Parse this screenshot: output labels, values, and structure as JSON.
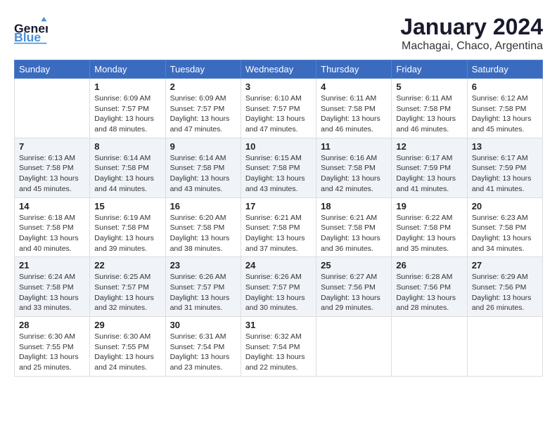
{
  "header": {
    "logo_general": "General",
    "logo_blue": "Blue",
    "month": "January 2024",
    "location": "Machagai, Chaco, Argentina"
  },
  "weekdays": [
    "Sunday",
    "Monday",
    "Tuesday",
    "Wednesday",
    "Thursday",
    "Friday",
    "Saturday"
  ],
  "weeks": [
    [
      {
        "day": "",
        "sunrise": "",
        "sunset": "",
        "daylight": ""
      },
      {
        "day": "1",
        "sunrise": "Sunrise: 6:09 AM",
        "sunset": "Sunset: 7:57 PM",
        "daylight": "Daylight: 13 hours and 48 minutes."
      },
      {
        "day": "2",
        "sunrise": "Sunrise: 6:09 AM",
        "sunset": "Sunset: 7:57 PM",
        "daylight": "Daylight: 13 hours and 47 minutes."
      },
      {
        "day": "3",
        "sunrise": "Sunrise: 6:10 AM",
        "sunset": "Sunset: 7:57 PM",
        "daylight": "Daylight: 13 hours and 47 minutes."
      },
      {
        "day": "4",
        "sunrise": "Sunrise: 6:11 AM",
        "sunset": "Sunset: 7:58 PM",
        "daylight": "Daylight: 13 hours and 46 minutes."
      },
      {
        "day": "5",
        "sunrise": "Sunrise: 6:11 AM",
        "sunset": "Sunset: 7:58 PM",
        "daylight": "Daylight: 13 hours and 46 minutes."
      },
      {
        "day": "6",
        "sunrise": "Sunrise: 6:12 AM",
        "sunset": "Sunset: 7:58 PM",
        "daylight": "Daylight: 13 hours and 45 minutes."
      }
    ],
    [
      {
        "day": "7",
        "sunrise": "Sunrise: 6:13 AM",
        "sunset": "Sunset: 7:58 PM",
        "daylight": "Daylight: 13 hours and 45 minutes."
      },
      {
        "day": "8",
        "sunrise": "Sunrise: 6:14 AM",
        "sunset": "Sunset: 7:58 PM",
        "daylight": "Daylight: 13 hours and 44 minutes."
      },
      {
        "day": "9",
        "sunrise": "Sunrise: 6:14 AM",
        "sunset": "Sunset: 7:58 PM",
        "daylight": "Daylight: 13 hours and 43 minutes."
      },
      {
        "day": "10",
        "sunrise": "Sunrise: 6:15 AM",
        "sunset": "Sunset: 7:58 PM",
        "daylight": "Daylight: 13 hours and 43 minutes."
      },
      {
        "day": "11",
        "sunrise": "Sunrise: 6:16 AM",
        "sunset": "Sunset: 7:58 PM",
        "daylight": "Daylight: 13 hours and 42 minutes."
      },
      {
        "day": "12",
        "sunrise": "Sunrise: 6:17 AM",
        "sunset": "Sunset: 7:59 PM",
        "daylight": "Daylight: 13 hours and 41 minutes."
      },
      {
        "day": "13",
        "sunrise": "Sunrise: 6:17 AM",
        "sunset": "Sunset: 7:59 PM",
        "daylight": "Daylight: 13 hours and 41 minutes."
      }
    ],
    [
      {
        "day": "14",
        "sunrise": "Sunrise: 6:18 AM",
        "sunset": "Sunset: 7:58 PM",
        "daylight": "Daylight: 13 hours and 40 minutes."
      },
      {
        "day": "15",
        "sunrise": "Sunrise: 6:19 AM",
        "sunset": "Sunset: 7:58 PM",
        "daylight": "Daylight: 13 hours and 39 minutes."
      },
      {
        "day": "16",
        "sunrise": "Sunrise: 6:20 AM",
        "sunset": "Sunset: 7:58 PM",
        "daylight": "Daylight: 13 hours and 38 minutes."
      },
      {
        "day": "17",
        "sunrise": "Sunrise: 6:21 AM",
        "sunset": "Sunset: 7:58 PM",
        "daylight": "Daylight: 13 hours and 37 minutes."
      },
      {
        "day": "18",
        "sunrise": "Sunrise: 6:21 AM",
        "sunset": "Sunset: 7:58 PM",
        "daylight": "Daylight: 13 hours and 36 minutes."
      },
      {
        "day": "19",
        "sunrise": "Sunrise: 6:22 AM",
        "sunset": "Sunset: 7:58 PM",
        "daylight": "Daylight: 13 hours and 35 minutes."
      },
      {
        "day": "20",
        "sunrise": "Sunrise: 6:23 AM",
        "sunset": "Sunset: 7:58 PM",
        "daylight": "Daylight: 13 hours and 34 minutes."
      }
    ],
    [
      {
        "day": "21",
        "sunrise": "Sunrise: 6:24 AM",
        "sunset": "Sunset: 7:58 PM",
        "daylight": "Daylight: 13 hours and 33 minutes."
      },
      {
        "day": "22",
        "sunrise": "Sunrise: 6:25 AM",
        "sunset": "Sunset: 7:57 PM",
        "daylight": "Daylight: 13 hours and 32 minutes."
      },
      {
        "day": "23",
        "sunrise": "Sunrise: 6:26 AM",
        "sunset": "Sunset: 7:57 PM",
        "daylight": "Daylight: 13 hours and 31 minutes."
      },
      {
        "day": "24",
        "sunrise": "Sunrise: 6:26 AM",
        "sunset": "Sunset: 7:57 PM",
        "daylight": "Daylight: 13 hours and 30 minutes."
      },
      {
        "day": "25",
        "sunrise": "Sunrise: 6:27 AM",
        "sunset": "Sunset: 7:56 PM",
        "daylight": "Daylight: 13 hours and 29 minutes."
      },
      {
        "day": "26",
        "sunrise": "Sunrise: 6:28 AM",
        "sunset": "Sunset: 7:56 PM",
        "daylight": "Daylight: 13 hours and 28 minutes."
      },
      {
        "day": "27",
        "sunrise": "Sunrise: 6:29 AM",
        "sunset": "Sunset: 7:56 PM",
        "daylight": "Daylight: 13 hours and 26 minutes."
      }
    ],
    [
      {
        "day": "28",
        "sunrise": "Sunrise: 6:30 AM",
        "sunset": "Sunset: 7:55 PM",
        "daylight": "Daylight: 13 hours and 25 minutes."
      },
      {
        "day": "29",
        "sunrise": "Sunrise: 6:30 AM",
        "sunset": "Sunset: 7:55 PM",
        "daylight": "Daylight: 13 hours and 24 minutes."
      },
      {
        "day": "30",
        "sunrise": "Sunrise: 6:31 AM",
        "sunset": "Sunset: 7:54 PM",
        "daylight": "Daylight: 13 hours and 23 minutes."
      },
      {
        "day": "31",
        "sunrise": "Sunrise: 6:32 AM",
        "sunset": "Sunset: 7:54 PM",
        "daylight": "Daylight: 13 hours and 22 minutes."
      },
      {
        "day": "",
        "sunrise": "",
        "sunset": "",
        "daylight": ""
      },
      {
        "day": "",
        "sunrise": "",
        "sunset": "",
        "daylight": ""
      },
      {
        "day": "",
        "sunrise": "",
        "sunset": "",
        "daylight": ""
      }
    ]
  ]
}
